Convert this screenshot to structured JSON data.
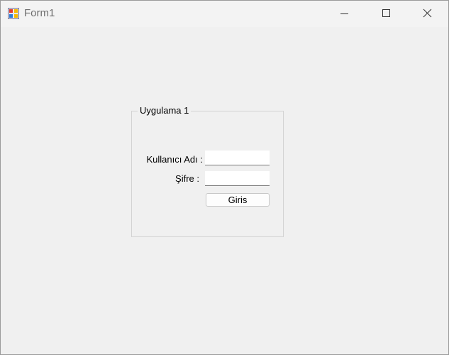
{
  "window": {
    "title": "Form1",
    "icon": "windows-forms-app-icon",
    "controls": {
      "minimize": "minimize-icon",
      "maximize": "maximize-icon",
      "close": "close-icon"
    }
  },
  "form": {
    "group_title": "Uygulama 1",
    "username_label": "Kullanıcı Adı :",
    "username_value": "",
    "password_label": "Şifre :",
    "password_value": "",
    "login_button": "Giris"
  },
  "colors": {
    "window_background": "#f0f0f0",
    "titlebar_background": "#f3f3f3",
    "groupbox_border": "#d3d3d3",
    "input_background": "#ffffff"
  }
}
